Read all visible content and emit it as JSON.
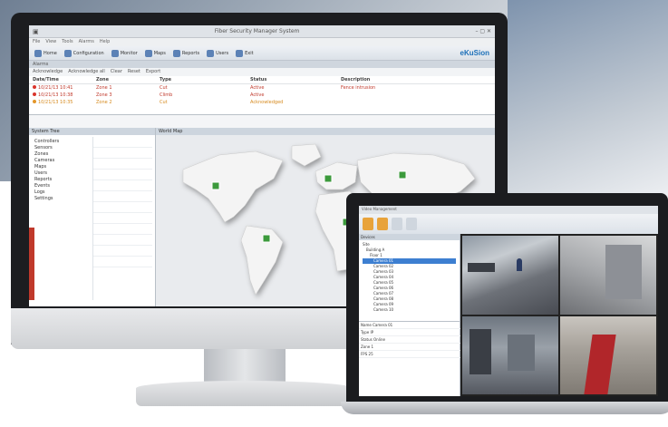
{
  "monitor_app": {
    "window_title": "Fiber Security Manager System",
    "menu": [
      "File",
      "View",
      "Tools",
      "Alarms",
      "Help"
    ],
    "toolbar": [
      {
        "label": "Home",
        "icon": "home-icon"
      },
      {
        "label": "Configuration",
        "icon": "gear-icon"
      },
      {
        "label": "Monitor",
        "icon": "monitor-icon"
      },
      {
        "label": "Maps",
        "icon": "map-icon"
      },
      {
        "label": "Reports",
        "icon": "report-icon"
      },
      {
        "label": "Users",
        "icon": "users-icon"
      },
      {
        "label": "Exit",
        "icon": "exit-icon"
      }
    ],
    "brand": "eKuSion",
    "alarm_tools": [
      "Acknowledge",
      "Acknowledge all",
      "Clear",
      "Reset",
      "Export"
    ],
    "alarm_columns": [
      "Date/Time",
      "Zone",
      "Type",
      "Status",
      "Description"
    ],
    "alarm_rows": [
      {
        "c1": "10/21/13 10:41",
        "c2": "Zone 1",
        "c3": "Cut",
        "c4": "Active",
        "c5": "Fence intrusion"
      },
      {
        "c1": "10/21/13 10:38",
        "c2": "Zone 3",
        "c3": "Climb",
        "c4": "Active",
        "c5": ""
      },
      {
        "c1": "10/21/13 10:35",
        "c2": "Zone 2",
        "c3": "Cut",
        "c4": "Acknowledged",
        "c5": ""
      }
    ],
    "left_panel_title": "System Tree",
    "tree_items": [
      "Controllers",
      "Sensors",
      "Zones",
      "Cameras",
      "Maps",
      "Users",
      "Reports",
      "Events",
      "Logs",
      "Settings"
    ],
    "map_panel_title": "World Map"
  },
  "laptop_app": {
    "window_title": "Video Management",
    "tree_title": "Devices",
    "tree_items": [
      "Site",
      "Building A",
      "Floor 1",
      "Camera 01",
      "Camera 02",
      "Camera 03",
      "Camera 04",
      "Camera 05",
      "Camera 06",
      "Camera 07",
      "Camera 08",
      "Camera 09",
      "Camera 10"
    ],
    "selected_index": 3,
    "props": [
      {
        "k": "Name",
        "v": "Camera 01"
      },
      {
        "k": "Type",
        "v": "IP"
      },
      {
        "k": "Status",
        "v": "Online"
      },
      {
        "k": "Zone",
        "v": "1"
      },
      {
        "k": "FPS",
        "v": "25"
      }
    ]
  }
}
